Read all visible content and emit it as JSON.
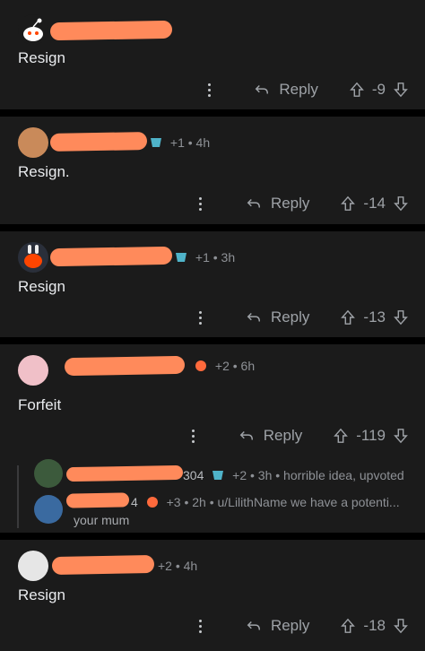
{
  "comments": [
    {
      "flair": "",
      "meta": "",
      "body": "Resign",
      "reply": "Reply",
      "score": "-9"
    },
    {
      "flair": "+1",
      "meta": "• 4h",
      "body": "Resign.",
      "reply": "Reply",
      "score": "-14"
    },
    {
      "flair": "+1",
      "meta": "• 3h",
      "body": "Resign",
      "reply": "Reply",
      "score": "-13"
    },
    {
      "flair": "+2",
      "meta": "• 6h",
      "body": "Forfeit",
      "reply": "Reply",
      "score": "-119"
    },
    {
      "flair": "+2",
      "meta": "• 4h",
      "body": "Resign",
      "reply": "Reply",
      "score": "-18"
    }
  ],
  "replies": [
    {
      "name_suffix": "304",
      "flair": "+2",
      "meta": "• 3h • horrible idea, upvoted"
    },
    {
      "name_suffix": "4",
      "flair": "+3",
      "meta": "• 2h • u/LilithName we have a potenti...",
      "preview": "your mum"
    }
  ],
  "colors": {
    "background": "#000000",
    "card": "#1b1b1b",
    "redaction": "#ff8a5b"
  }
}
